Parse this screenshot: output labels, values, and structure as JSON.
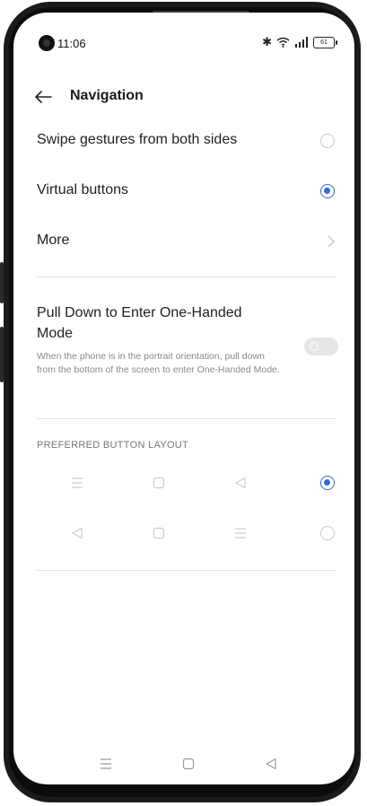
{
  "status": {
    "time": "11:06",
    "battery": "61",
    "icons": [
      "bluetooth-icon",
      "wifi-icon",
      "signal-icon",
      "battery-icon"
    ]
  },
  "header": {
    "back_icon": "arrow-left-icon",
    "title": "Navigation"
  },
  "options": {
    "swipe_label": "Swipe gestures from both sides",
    "swipe_selected": false,
    "virtual_label": "Virtual buttons",
    "virtual_selected": true,
    "more_label": "More"
  },
  "one_handed": {
    "title": "Pull Down to Enter One-Handed Mode",
    "description": "When the phone is in the portrait orientation, pull down from the bottom of the screen to enter One-Handed Mode.",
    "enabled": false
  },
  "button_layout": {
    "header": "PREFERRED BUTTON LAYOUT",
    "layouts": [
      {
        "order": [
          "menu-icon",
          "home-square-icon",
          "back-triangle-icon"
        ],
        "selected": true
      },
      {
        "order": [
          "back-triangle-icon",
          "home-square-icon",
          "menu-icon"
        ],
        "selected": false
      }
    ]
  },
  "navbar": {
    "icons": [
      "menu-icon",
      "home-square-icon",
      "back-triangle-icon"
    ]
  },
  "colors": {
    "accent": "#2f6bd6",
    "text": "#1f1f1f",
    "secondary_text": "#8a8a8a",
    "divider": "#e4e4e4"
  }
}
